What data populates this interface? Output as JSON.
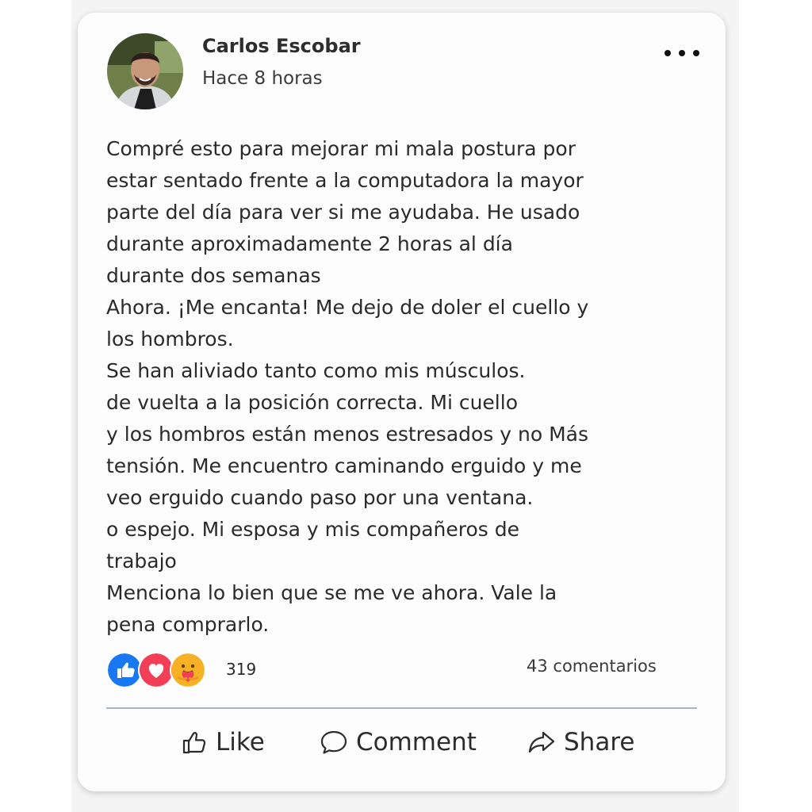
{
  "post": {
    "author": "Carlos Escobar",
    "time": "Hace 8 horas",
    "more_icon": "more-horizontal-icon",
    "body_lines": [
      "Compré esto para mejorar mi mala postura por",
      "estar sentado frente a la computadora la mayor",
      "parte del día para ver si me ayudaba. He usado",
      "durante aproximadamente 2 horas al día",
      "durante dos semanas",
      "Ahora. ¡Me encanta! Me dejo de doler el cuello y",
      "los hombros.",
      "Se han aliviado tanto como mis músculos.",
      "de vuelta a la posición correcta. Mi cuello",
      "y los hombros están menos estresados y no Más",
      "tensión. Me encuentro caminando erguido y me",
      "veo erguido cuando paso por una ventana.",
      "o espejo. Mi esposa y mis compañeros de",
      "trabajo",
      "Menciona lo bien que se me ve ahora. Vale la",
      "pena comprarlo."
    ]
  },
  "reactions": {
    "icons": [
      "like-reaction-icon",
      "love-reaction-icon",
      "care-reaction-icon"
    ],
    "count": "319",
    "comments": "43 comentarios"
  },
  "actions": {
    "like": "Like",
    "comment": "Comment",
    "share": "Share"
  },
  "colors": {
    "like_blue": "#1877f2",
    "love_red": "#f33e58",
    "care_yellow": "#f7b125",
    "divider": "#a9b4c9"
  }
}
